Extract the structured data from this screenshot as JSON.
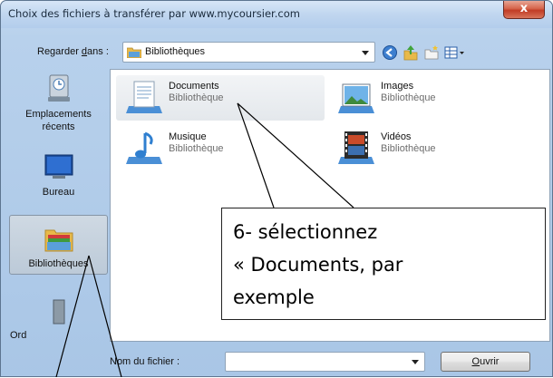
{
  "window": {
    "title": "Choix des fichiers à transférer par www.mycoursier.com",
    "close_glyph": "x"
  },
  "look_in": {
    "label_prefix": "Regarder ",
    "label_accel": "d",
    "label_suffix": "ans :",
    "value": "Bibliothèques",
    "icon": "library-folder-icon"
  },
  "toolbar": {
    "icons": [
      "back-icon",
      "up-folder-icon",
      "new-folder-icon",
      "view-menu-icon"
    ]
  },
  "places": [
    {
      "label_lines": [
        "Emplacements",
        "récents"
      ],
      "icon": "recent-places-icon",
      "selected": false
    },
    {
      "label_lines": [
        "Bureau"
      ],
      "icon": "desktop-icon",
      "selected": false
    },
    {
      "label_lines": [
        "Bibliothèques"
      ],
      "icon": "libraries-icon",
      "selected": true
    },
    {
      "label_lines": [
        "Ord"
      ],
      "icon": "computer-icon",
      "selected": false
    }
  ],
  "libraries": [
    {
      "name": "Documents",
      "subtitle": "Bibliothèque",
      "icon": "documents-library-icon",
      "hover": true
    },
    {
      "name": "Images",
      "subtitle": "Bibliothèque",
      "icon": "images-library-icon",
      "hover": false
    },
    {
      "name": "Musique",
      "subtitle": "Bibliothèque",
      "icon": "music-library-icon",
      "hover": false
    },
    {
      "name": "Vidéos",
      "subtitle": "Bibliothèque",
      "icon": "videos-library-icon",
      "hover": false
    }
  ],
  "filename": {
    "label": "Nom du fichier :",
    "value": ""
  },
  "open_button": {
    "accel": "O",
    "rest": "uvrir"
  },
  "callout": {
    "lines": [
      "6- sélectionnez",
      "« Documents, par",
      "exemple"
    ]
  },
  "colors": {
    "frame": "#b8d1ec",
    "close": "#c13c25",
    "selection": "#bccad8"
  }
}
